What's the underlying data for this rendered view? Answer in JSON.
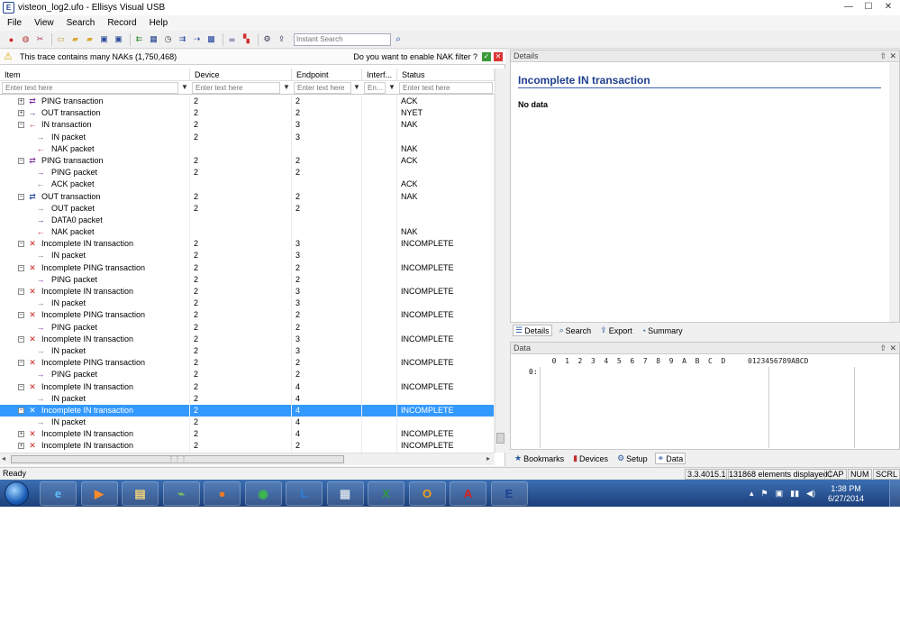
{
  "window": {
    "title": "visteon_log2.ufo - Ellisys Visual USB",
    "icon_letter": "E",
    "minimize": "—",
    "maximize": "☐",
    "close": "✕"
  },
  "menu": [
    "File",
    "View",
    "Search",
    "Record",
    "Help"
  ],
  "toolbar": {
    "search_placeholder": "Instant Search",
    "icons": [
      "record-icon",
      "stop-icon",
      "clear-icon",
      "new-icon",
      "open-icon",
      "open-folder-icon",
      "save-icon",
      "save-as-icon",
      "back-icon",
      "filter-icon",
      "timer-icon",
      "transaction-icon",
      "packet-icon",
      "grid-icon",
      "binoculars-icon",
      "palette-icon",
      "settings-icon",
      "export-icon"
    ]
  },
  "nak_bar": {
    "message": "This trace contains many NAKs (1,750,468)",
    "question": "Do you want to enable NAK filter ?",
    "yes": "✓",
    "no": "✕"
  },
  "columns": [
    {
      "key": "item",
      "label": "Item",
      "placeholder": "Enter text here"
    },
    {
      "key": "device",
      "label": "Device",
      "placeholder": "Enter text here"
    },
    {
      "key": "endpoint",
      "label": "Endpoint",
      "placeholder": "Enter text here"
    },
    {
      "key": "interface",
      "label": "Interf...",
      "placeholder": "En..."
    },
    {
      "key": "status",
      "label": "Status",
      "placeholder": "Enter text here"
    }
  ],
  "rows": [
    {
      "level": 0,
      "exp": "+",
      "icon": "⇄",
      "color": "#7a2a9a",
      "label": "PING transaction",
      "device": "2",
      "endpoint": "2",
      "interface": "",
      "status": "ACK"
    },
    {
      "level": 0,
      "exp": "+",
      "icon": "→",
      "color": "#1a3a9a",
      "label": "OUT transaction",
      "device": "2",
      "endpoint": "2",
      "interface": "",
      "status": "NYET"
    },
    {
      "level": 0,
      "exp": "−",
      "icon": "←",
      "color": "#cc2222",
      "label": "IN transaction",
      "device": "2",
      "endpoint": "3",
      "interface": "",
      "status": "NAK"
    },
    {
      "level": 1,
      "exp": "",
      "icon": "→",
      "color": "#777777",
      "label": "IN packet",
      "device": "2",
      "endpoint": "3",
      "interface": "",
      "status": ""
    },
    {
      "level": 1,
      "exp": "",
      "icon": "←",
      "color": "#cc2222",
      "label": "NAK packet",
      "device": "",
      "endpoint": "",
      "interface": "",
      "status": "NAK"
    },
    {
      "level": 0,
      "exp": "−",
      "icon": "⇄",
      "color": "#7a2a9a",
      "label": "PING transaction",
      "device": "2",
      "endpoint": "2",
      "interface": "",
      "status": "ACK"
    },
    {
      "level": 1,
      "exp": "",
      "icon": "→",
      "color": "#7a2a9a",
      "label": "PING packet",
      "device": "2",
      "endpoint": "2",
      "interface": "",
      "status": ""
    },
    {
      "level": 1,
      "exp": "",
      "icon": "←",
      "color": "#777777",
      "label": "ACK packet",
      "device": "",
      "endpoint": "",
      "interface": "",
      "status": "ACK"
    },
    {
      "level": 0,
      "exp": "−",
      "icon": "⇄",
      "color": "#1a3a9a",
      "label": "OUT transaction",
      "device": "2",
      "endpoint": "2",
      "interface": "",
      "status": "NAK"
    },
    {
      "level": 1,
      "exp": "",
      "icon": "→",
      "color": "#777777",
      "label": "OUT packet",
      "device": "2",
      "endpoint": "2",
      "interface": "",
      "status": ""
    },
    {
      "level": 1,
      "exp": "",
      "icon": "→",
      "color": "#1a3a9a",
      "label": "DATA0 packet",
      "device": "",
      "endpoint": "",
      "interface": "",
      "status": ""
    },
    {
      "level": 1,
      "exp": "",
      "icon": "←",
      "color": "#cc2222",
      "label": "NAK packet",
      "device": "",
      "endpoint": "",
      "interface": "",
      "status": "NAK"
    },
    {
      "level": 0,
      "exp": "−",
      "icon": "✕",
      "color": "#cc2222",
      "label": "Incomplete IN transaction",
      "device": "2",
      "endpoint": "3",
      "interface": "",
      "status": "INCOMPLETE"
    },
    {
      "level": 1,
      "exp": "",
      "icon": "→",
      "color": "#777777",
      "label": "IN packet",
      "device": "2",
      "endpoint": "3",
      "interface": "",
      "status": ""
    },
    {
      "level": 0,
      "exp": "−",
      "icon": "✕",
      "color": "#cc2222",
      "label": "Incomplete PING transaction",
      "device": "2",
      "endpoint": "2",
      "interface": "",
      "status": "INCOMPLETE"
    },
    {
      "level": 1,
      "exp": "",
      "icon": "→",
      "color": "#7a2a9a",
      "label": "PING packet",
      "device": "2",
      "endpoint": "2",
      "interface": "",
      "status": ""
    },
    {
      "level": 0,
      "exp": "−",
      "icon": "✕",
      "color": "#cc2222",
      "label": "Incomplete IN transaction",
      "device": "2",
      "endpoint": "3",
      "interface": "",
      "status": "INCOMPLETE"
    },
    {
      "level": 1,
      "exp": "",
      "icon": "→",
      "color": "#777777",
      "label": "IN packet",
      "device": "2",
      "endpoint": "3",
      "interface": "",
      "status": ""
    },
    {
      "level": 0,
      "exp": "−",
      "icon": "✕",
      "color": "#cc2222",
      "label": "Incomplete PING transaction",
      "device": "2",
      "endpoint": "2",
      "interface": "",
      "status": "INCOMPLETE"
    },
    {
      "level": 1,
      "exp": "",
      "icon": "→",
      "color": "#7a2a9a",
      "label": "PING packet",
      "device": "2",
      "endpoint": "2",
      "interface": "",
      "status": ""
    },
    {
      "level": 0,
      "exp": "−",
      "icon": "✕",
      "color": "#cc2222",
      "label": "Incomplete IN transaction",
      "device": "2",
      "endpoint": "3",
      "interface": "",
      "status": "INCOMPLETE"
    },
    {
      "level": 1,
      "exp": "",
      "icon": "→",
      "color": "#777777",
      "label": "IN packet",
      "device": "2",
      "endpoint": "3",
      "interface": "",
      "status": ""
    },
    {
      "level": 0,
      "exp": "−",
      "icon": "✕",
      "color": "#cc2222",
      "label": "Incomplete PING transaction",
      "device": "2",
      "endpoint": "2",
      "interface": "",
      "status": "INCOMPLETE"
    },
    {
      "level": 1,
      "exp": "",
      "icon": "→",
      "color": "#7a2a9a",
      "label": "PING packet",
      "device": "2",
      "endpoint": "2",
      "interface": "",
      "status": ""
    },
    {
      "level": 0,
      "exp": "−",
      "icon": "✕",
      "color": "#cc2222",
      "label": "Incomplete IN transaction",
      "device": "2",
      "endpoint": "4",
      "interface": "",
      "status": "INCOMPLETE"
    },
    {
      "level": 1,
      "exp": "",
      "icon": "→",
      "color": "#777777",
      "label": "IN packet",
      "device": "2",
      "endpoint": "4",
      "interface": "",
      "status": ""
    },
    {
      "level": 0,
      "exp": "−",
      "icon": "✕",
      "color": "#cc2222",
      "label": "Incomplete IN transaction",
      "device": "2",
      "endpoint": "4",
      "interface": "",
      "status": "INCOMPLETE",
      "selected": true
    },
    {
      "level": 1,
      "exp": "",
      "icon": "→",
      "color": "#777777",
      "label": "IN packet",
      "device": "2",
      "endpoint": "4",
      "interface": "",
      "status": ""
    },
    {
      "level": 0,
      "exp": "+",
      "icon": "✕",
      "color": "#cc2222",
      "label": "Incomplete IN transaction",
      "device": "2",
      "endpoint": "4",
      "interface": "",
      "status": "INCOMPLETE"
    },
    {
      "level": 0,
      "exp": "+",
      "icon": "✕",
      "color": "#cc2222",
      "label": "Incomplete IN transaction",
      "device": "2",
      "endpoint": "2",
      "interface": "",
      "status": "INCOMPLETE"
    }
  ],
  "details": {
    "header": "Details",
    "title": "Incomplete IN transaction",
    "body": "No data",
    "pin": "⇧",
    "close": "✕"
  },
  "details_tabs": [
    {
      "label": "Details",
      "icon": "☰",
      "active": true
    },
    {
      "label": "Search",
      "icon": "⌕",
      "active": false
    },
    {
      "label": "Export",
      "icon": "⇪",
      "active": false
    },
    {
      "label": "Summary",
      "icon": "◔",
      "active": false
    }
  ],
  "data_pane": {
    "header": "Data",
    "hex_header": "  0  1  2  3  4  5  6  7  8  9  A  B  C  D",
    "ascii_header": "0123456789ABCD",
    "address": "0:"
  },
  "bottom_tabs": [
    {
      "label": "Bookmarks",
      "icon": "★",
      "active": false
    },
    {
      "label": "Devices",
      "icon": "▮",
      "active": false
    },
    {
      "label": "Setup",
      "icon": "⚙",
      "active": false
    },
    {
      "label": "Data",
      "icon": "⚭",
      "active": true
    }
  ],
  "status": {
    "ready": "Ready",
    "version": "3.3.4015.1",
    "elements": "131868 elements displayed",
    "cap": "CAP",
    "num": "NUM",
    "scrl": "SCRL"
  },
  "taskbar": {
    "apps": [
      {
        "name": "internet-explorer",
        "glyph": "e",
        "color": "#5fc0ff"
      },
      {
        "name": "media-player",
        "glyph": "▶",
        "color": "#ff8a2a"
      },
      {
        "name": "file-explorer",
        "glyph": "▤",
        "color": "#f4d479"
      },
      {
        "name": "chart-tool",
        "glyph": "⌁",
        "color": "#79c060"
      },
      {
        "name": "firefox",
        "glyph": "●",
        "color": "#f07a24"
      },
      {
        "name": "chrome",
        "glyph": "◉",
        "color": "#3dbb4a"
      },
      {
        "name": "lync",
        "glyph": "L",
        "color": "#2e7fd6"
      },
      {
        "name": "calculator",
        "glyph": "▦",
        "color": "#cfd8e6"
      },
      {
        "name": "excel",
        "glyph": "X",
        "color": "#2f9a45"
      },
      {
        "name": "outlook",
        "glyph": "O",
        "color": "#f0a020"
      },
      {
        "name": "acrobat",
        "glyph": "A",
        "color": "#d42020"
      },
      {
        "name": "ellisys",
        "glyph": "E",
        "color": "#1e3f8e"
      }
    ],
    "time": "1:38 PM",
    "date": "6/27/2014",
    "tray_icons": [
      "▴",
      "⚑",
      "▣",
      "▮▮",
      "◀)"
    ]
  }
}
